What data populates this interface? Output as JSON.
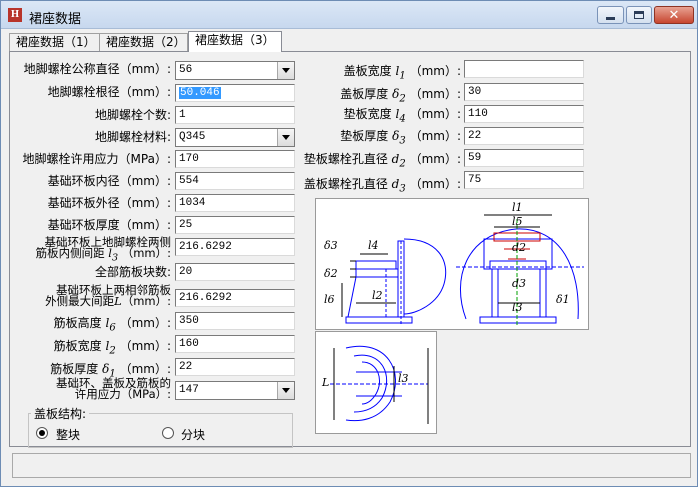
{
  "window": {
    "title": "裙座数据",
    "app_icon": "H"
  },
  "tabs": [
    {
      "label": "裙座数据（1）"
    },
    {
      "label": "裙座数据（2）"
    },
    {
      "label": "裙座数据（3）"
    }
  ],
  "form": {
    "bolt_nominal_diameter": {
      "label": "地脚螺栓公称直径（mm）:",
      "value": "56"
    },
    "bolt_root_diameter": {
      "label": "地脚螺栓根径（mm）:",
      "value": "50.046"
    },
    "bolt_count": {
      "label": "地脚螺栓个数:",
      "value": "1"
    },
    "bolt_material": {
      "label": "地脚螺栓材料:",
      "value": "Q345"
    },
    "bolt_allowable_stress": {
      "label": "地脚螺栓许用应力（MPa）:",
      "value": "170"
    },
    "ring_inner_diameter": {
      "label": "基础环板内径（mm）:",
      "value": "554"
    },
    "ring_outer_diameter": {
      "label": "基础环板外径（mm）:",
      "value": "1034"
    },
    "ring_thickness": {
      "label": "基础环板厚度（mm）:",
      "value": "25"
    },
    "rib_inner_spacing": {
      "line1": "基础环板上地脚螺栓两侧",
      "line2": "筋板内侧间距",
      "sym": "l",
      "sub": "3",
      "unit": "（mm）:",
      "value": "216.6292"
    },
    "rib_total_count": {
      "label": "全部筋板块数:",
      "value": "20"
    },
    "rib_outer_spacing": {
      "line1": "基础环板上两相邻筋板",
      "line2": "外侧最大间距",
      "sym": "L",
      "unit": "（mm）:",
      "value": "216.6292"
    },
    "rib_height": {
      "label": "筋板高度",
      "sym": "l",
      "sub": "6",
      "unit": "（mm）:",
      "value": "350"
    },
    "rib_width": {
      "label": "筋板宽度",
      "sym": "l",
      "sub": "2",
      "unit": "（mm）:",
      "value": "160"
    },
    "rib_thickness": {
      "label": "筋板厚度",
      "sym": "δ",
      "sub": "1",
      "unit": "（mm）:",
      "value": "22"
    },
    "allowable_stress": {
      "line1": "基础环、盖板及筋板的",
      "line2": "许用应力（MPa）:",
      "value": "147"
    },
    "cover_width": {
      "label": "盖板宽度",
      "sym": "l",
      "sub": "1",
      "unit": "（mm）:",
      "value": ""
    },
    "cover_thickness": {
      "label": "盖板厚度",
      "sym": "δ",
      "sub": "2",
      "unit": "（mm）:",
      "value": "30"
    },
    "pad_width": {
      "label": "垫板宽度",
      "sym": "l",
      "sub": "4",
      "unit": "（mm）:",
      "value": "110"
    },
    "pad_thickness": {
      "label": "垫板厚度",
      "sym": "δ",
      "sub": "3",
      "unit": "（mm）:",
      "value": "22"
    },
    "pad_bolt_hole": {
      "label": "垫板螺栓孔直径",
      "sym": "d",
      "sub": "2",
      "unit": "（mm）:",
      "value": "59"
    },
    "cover_bolt_hole": {
      "label": "盖板螺栓孔直径",
      "sym": "d",
      "sub": "3",
      "unit": "（mm）:",
      "value": "75"
    }
  },
  "cover_structure": {
    "title": "盖板结构:",
    "options": [
      {
        "label": "整块",
        "selected": true
      },
      {
        "label": "分块",
        "selected": false
      }
    ]
  },
  "figure": {
    "labels": {
      "l1": "l1",
      "l5": "l5",
      "d2": "d2",
      "d3": "d3",
      "l3": "l3",
      "delta1": "δ1",
      "delta2": "δ2",
      "delta3": "δ3",
      "l4": "l4",
      "l6": "l6",
      "l2": "l2",
      "L": "L"
    }
  },
  "colors": {
    "title_bar": "#c7d8ee",
    "selection": "#3399ff",
    "drawing_line": "#0000ff",
    "dimension_red": "#cc0000"
  }
}
